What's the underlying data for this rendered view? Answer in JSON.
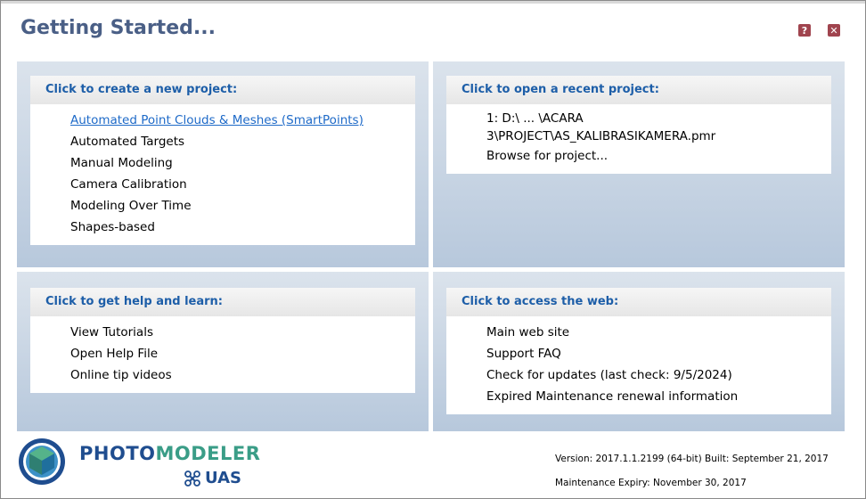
{
  "window": {
    "title": "Getting Started...",
    "help_icon_label": "?",
    "close_icon_label": "✕"
  },
  "panels": {
    "new_project": {
      "header": "Click to create a new project:",
      "items": [
        "Automated Point Clouds & Meshes (SmartPoints)",
        "Automated Targets",
        "Manual Modeling",
        "Camera Calibration",
        "Modeling Over Time",
        "Shapes-based"
      ]
    },
    "recent_project": {
      "header": "Click to open a recent project:",
      "items": [
        "1: D:\\ ... \\ACARA",
        "3\\PROJECT\\AS_KALIBRASIKAMERA.pmr",
        "Browse for project..."
      ]
    },
    "help": {
      "header": "Click to get help and learn:",
      "items": [
        "View Tutorials",
        "Open Help File",
        "Online tip videos"
      ]
    },
    "web": {
      "header": "Click to access the web:",
      "items": [
        "Main web site",
        "Support FAQ",
        "Check for updates (last check: 9/5/2024)",
        "Expired Maintenance renewal information"
      ]
    }
  },
  "footer": {
    "brand_photo": "PHOTO",
    "brand_modeler": "MODELER",
    "brand_uas": "UAS",
    "version": "Version: 2017.1.1.2199 (64-bit) Built: September 21, 2017",
    "expiry": "Maintenance Expiry: November 30, 2017"
  },
  "colors": {
    "title": "#4a5f86",
    "header_text": "#1d5ea8",
    "link": "#1e6ac8",
    "panel_top": "#dbe3ec",
    "panel_bottom": "#b7c8dc"
  },
  "icons": {
    "help": "help-icon",
    "close": "close-icon",
    "logo": "photomodeler-logo-icon",
    "drone": "drone-icon"
  }
}
